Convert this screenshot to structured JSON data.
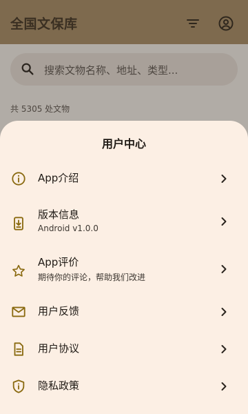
{
  "app": {
    "title": "全国文保库",
    "search_placeholder": "搜索文物名称、地址、类型...",
    "count_text": "共 5305 处文物"
  },
  "sheet": {
    "title": "用户中心",
    "items": [
      {
        "label": "App介绍",
        "icon": "info-icon"
      },
      {
        "label": "版本信息",
        "subtitle": "Android v1.0.0",
        "icon": "version-download-icon"
      },
      {
        "label": "App评价",
        "subtitle": "期待你的评论，帮助我们改进",
        "icon": "star-icon"
      },
      {
        "label": "用户反馈",
        "icon": "mail-icon"
      },
      {
        "label": "用户协议",
        "icon": "document-icon"
      },
      {
        "label": "隐私政策",
        "icon": "shield-icon"
      }
    ]
  },
  "colors": {
    "accent": "#8a6a10",
    "sheet_bg": "#fcefe4",
    "scrim": "#b1aca6"
  }
}
